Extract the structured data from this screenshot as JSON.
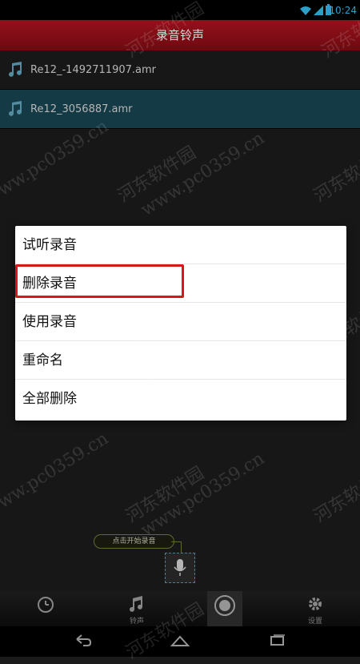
{
  "status": {
    "time": "10:24"
  },
  "title": "录音铃声",
  "recordings": [
    {
      "name": "Re12_-1492711907.amr",
      "selected": false
    },
    {
      "name": "Re12_3056887.amr",
      "selected": true
    }
  ],
  "context_menu": {
    "items": [
      "试听录音",
      "删除录音",
      "使用录音",
      "重命名",
      "全部删除"
    ],
    "highlighted_index": 1
  },
  "record_hint": "点击开始录音",
  "tabs": [
    {
      "label": "",
      "icon": "alarm-clock-icon"
    },
    {
      "label": "铃声",
      "icon": "music-notes-icon"
    },
    {
      "label": "",
      "icon": "record-icon",
      "active": true
    },
    {
      "label": "设置",
      "icon": "gear-icon"
    }
  ],
  "navbar": {
    "icons": [
      "back-icon",
      "home-icon",
      "recents-icon"
    ]
  },
  "watermark": {
    "site_cn": "河东软件园",
    "site_url": "www.pc0359.cn"
  },
  "colors": {
    "title_red": "#a8141f",
    "selected_row": "#17424f",
    "highlight_red": "#d9161a",
    "accent_blue": "#33b5e5"
  }
}
